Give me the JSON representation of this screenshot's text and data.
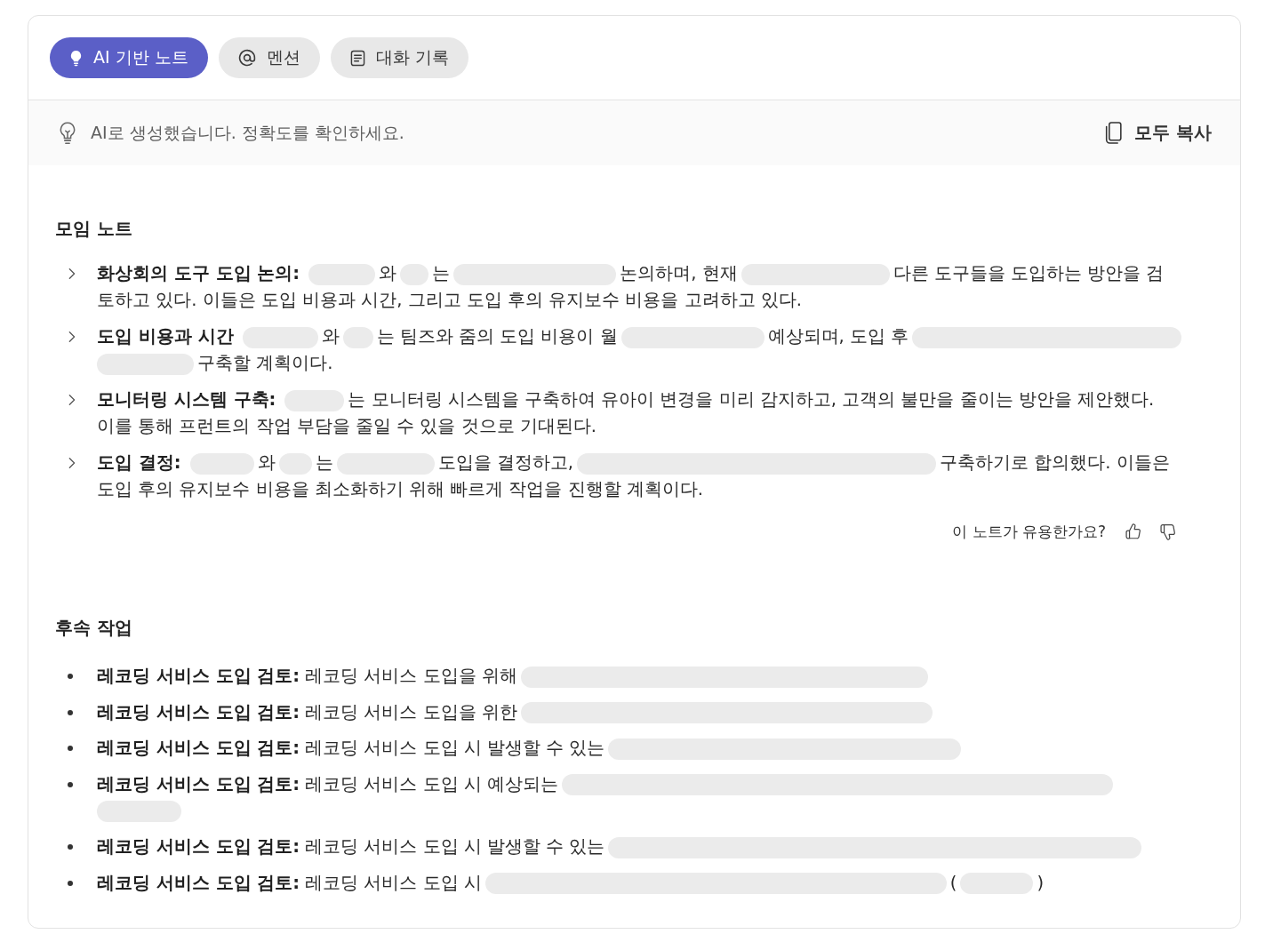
{
  "tabs": [
    {
      "label": "AI 기반 노트",
      "selected": true
    },
    {
      "label": "멘션",
      "selected": false
    },
    {
      "label": "대화 기록",
      "selected": false
    }
  ],
  "notice": {
    "text": "AI로 생성했습니다. 정확도를 확인하세요.",
    "copy_button": "모두 복사"
  },
  "sections": [
    {
      "heading": "모임 노트",
      "kind": "chevron",
      "items": [
        {
          "title": "화상회의 도구 도입 논의:",
          "parts": [
            {
              "kind": "redacted"
            },
            {
              "kind": "text",
              "text": "와"
            },
            {
              "kind": "redacted"
            },
            {
              "kind": "text",
              "text": "는"
            },
            {
              "kind": "redacted"
            },
            {
              "kind": "text",
              "text": "논의하며, 현재"
            },
            {
              "kind": "redacted"
            },
            {
              "kind": "text",
              "text": "다른 도구들을 도입하는 방안을 검"
            },
            {
              "kind": "text",
              "text": "토하고 있다. 이들은 도입 비용과 시간, 그리고 도입 후의 유지보수 비용을 고려하고 있다."
            }
          ]
        },
        {
          "title": "도입 비용과 시간",
          "parts": [
            {
              "kind": "redacted"
            },
            {
              "kind": "text",
              "text": "와"
            },
            {
              "kind": "redacted"
            },
            {
              "kind": "text",
              "text": "는 팀즈와 줌의 도입 비용이 월"
            },
            {
              "kind": "redacted"
            },
            {
              "kind": "text",
              "text": "예상되며, 도입 후"
            },
            {
              "kind": "redacted"
            },
            {
              "kind": "redacted"
            },
            {
              "kind": "text",
              "text": "구축할 계획이다."
            }
          ]
        },
        {
          "title": "모니터링 시스템 구축:",
          "parts": [
            {
              "kind": "redacted"
            },
            {
              "kind": "text",
              "text": "는 모니터링 시스템을 구축하여 유아이 변경을 미리 감지하고, 고객의 불만을 줄이는 방안을 제안했다."
            },
            {
              "kind": "text",
              "text": "이를 통해 프런트의 작업 부담을 줄일 수 있을 것으로 기대된다."
            }
          ]
        },
        {
          "title": "도입 결정:",
          "parts": [
            {
              "kind": "redacted"
            },
            {
              "kind": "text",
              "text": "와"
            },
            {
              "kind": "redacted"
            },
            {
              "kind": "text",
              "text": "는"
            },
            {
              "kind": "redacted"
            },
            {
              "kind": "text",
              "text": "도입을 결정하고,"
            },
            {
              "kind": "redacted"
            },
            {
              "kind": "text",
              "text": "구축하기로 합의했다. 이들은"
            },
            {
              "kind": "text",
              "text": "도입 후의 유지보수 비용을 최소화하기 위해 빠르게 작업을 진행할 계획이다."
            }
          ]
        }
      ],
      "feedback": {
        "question": "이 노트가 유용한가요?"
      }
    },
    {
      "heading": "후속 작업",
      "kind": "bullet",
      "items": [
        {
          "title": "레코딩 서비스 도입 검토:",
          "parts": [
            {
              "kind": "text",
              "text": "레코딩 서비스 도입을 위해"
            },
            {
              "kind": "redacted"
            }
          ]
        },
        {
          "title": "레코딩 서비스 도입 검토:",
          "parts": [
            {
              "kind": "text",
              "text": "레코딩 서비스 도입을 위한"
            },
            {
              "kind": "redacted"
            }
          ]
        },
        {
          "title": "레코딩 서비스 도입 검토:",
          "parts": [
            {
              "kind": "text",
              "text": "레코딩 서비스 도입 시 발생할 수 있는"
            },
            {
              "kind": "redacted"
            }
          ]
        },
        {
          "title": "레코딩 서비스 도입 검토:",
          "parts": [
            {
              "kind": "text",
              "text": "레코딩 서비스 도입 시 예상되는"
            },
            {
              "kind": "redacted"
            },
            {
              "kind": "redacted"
            }
          ]
        },
        {
          "title": "레코딩 서비스 도입 검토:",
          "parts": [
            {
              "kind": "text",
              "text": "레코딩 서비스 도입 시 발생할 수 있는"
            },
            {
              "kind": "redacted"
            }
          ]
        },
        {
          "title": "레코딩 서비스 도입 검토:",
          "parts": [
            {
              "kind": "text",
              "text": "레코딩 서비스 도입 시"
            },
            {
              "kind": "redacted"
            },
            {
              "kind": "text",
              "text": "("
            },
            {
              "kind": "redacted"
            },
            {
              "kind": "text",
              "text": ")"
            }
          ]
        }
      ]
    }
  ]
}
